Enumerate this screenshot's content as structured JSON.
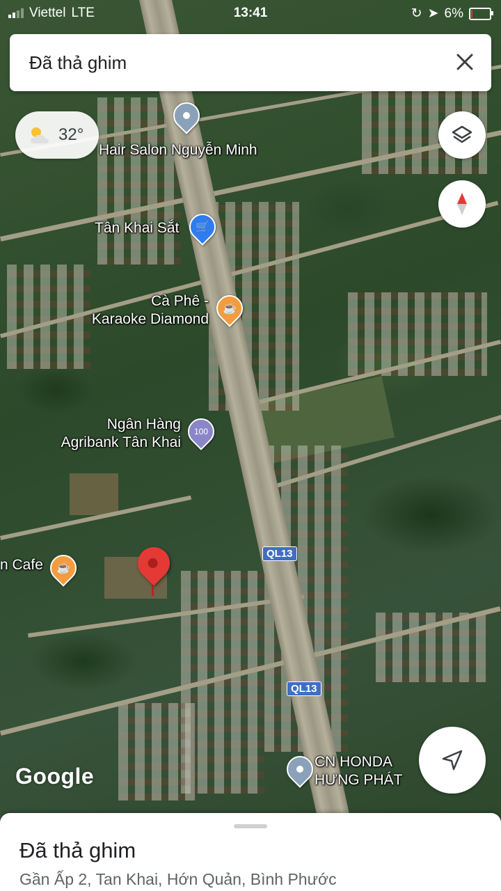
{
  "status_bar": {
    "carrier": "Viettel",
    "network": "LTE",
    "time": "13:41",
    "battery": "6%",
    "battery_level": 0.06
  },
  "search": {
    "title": "Đã thả ghim"
  },
  "weather": {
    "temperature": "32°",
    "icon": "partly-sunny-icon"
  },
  "map": {
    "places": [
      {
        "name": "Hair Salon Nguyễn Minh",
        "icon": "pin-icon"
      },
      {
        "name": "Tân Khai Sắt",
        "icon": "shopping-cart-icon"
      },
      {
        "line1": "Cà Phê -",
        "line2": "Karaoke Diamond",
        "icon": "coffee-icon"
      },
      {
        "line1": "Ngân Hàng",
        "line2": "Agribank Tân Khai",
        "icon": "bank-icon"
      },
      {
        "name": "n Cafe",
        "icon": "coffee-icon"
      },
      {
        "line1": "CN HONDA",
        "line2": "HƯNG PHÁT",
        "icon": "pin-icon"
      }
    ],
    "road_shields": [
      "QL13",
      "QL13"
    ],
    "watermark": "Google"
  },
  "controls": {
    "layers": "layers-icon",
    "compass": "compass-icon",
    "directions": "navigation-arrow-icon"
  },
  "bottom_sheet": {
    "title": "Đã thả ghim",
    "address": "Gần Ấp 2, Tan Khai, Hớn Quản, Bình Phước"
  }
}
